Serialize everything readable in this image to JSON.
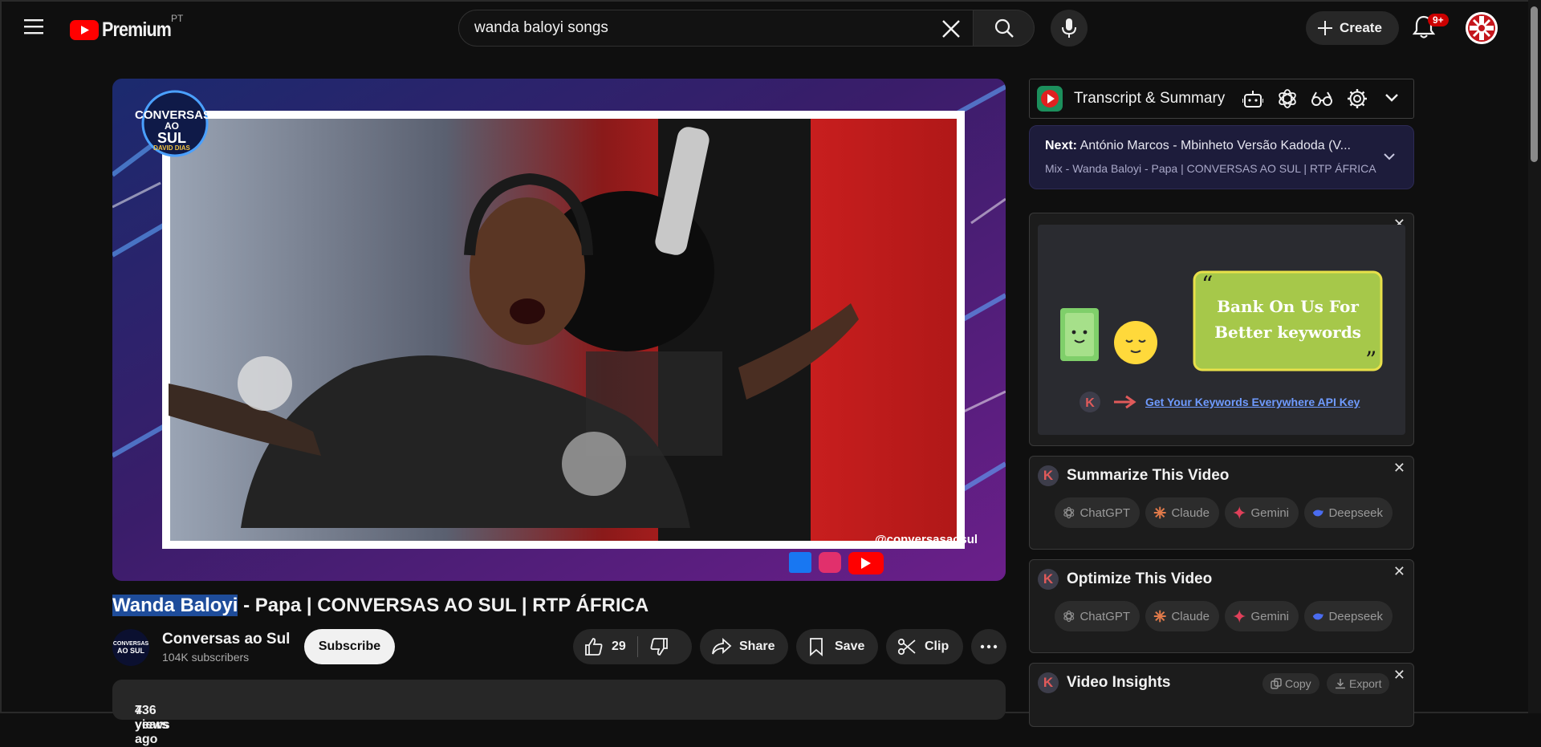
{
  "header": {
    "logo_text": "Premium",
    "country_code": "PT",
    "search_value": "wanda baloyi songs",
    "create_label": "Create",
    "notification_badge": "9+"
  },
  "video": {
    "watermark_handle": "@conversasaosul",
    "overlay_logo_line1": "CONVERSAS",
    "overlay_logo_line2": "AO",
    "overlay_logo_line3": "SUL",
    "overlay_logo_line4": "DAVID DIAS",
    "title_highlight": "Wanda Baloyi",
    "title_rest": " - Papa | CONVERSAS AO SUL | RTP ÁFRICA",
    "channel_name": "Conversas ao Sul",
    "subscribers": "104K subscribers",
    "subscribe_label": "Subscribe",
    "like_count": "29",
    "share_label": "Share",
    "save_label": "Save",
    "clip_label": "Clip",
    "views": "736 views",
    "age": "4 years ago"
  },
  "sidebar": {
    "transcript_title": "Transcript & Summary",
    "next_label": "Next:",
    "next_title": "António Marcos - Mbinheto Versão Kadoda (V...",
    "next_mix": "Mix - Wanda Baloyi - Papa | CONVERSAS AO SUL | RTP ÁFRICA",
    "ad_line1": "Bank On Us For",
    "ad_line2": "Better keywords",
    "ad_link": "Get Your Keywords Everywhere API Key",
    "summarize_title": "Summarize This Video",
    "optimize_title": "Optimize This Video",
    "insights_title": "Video Insights",
    "copy_label": "Copy",
    "export_label": "Export",
    "ai_buttons": [
      "ChatGPT",
      "Claude",
      "Gemini",
      "Deepseek"
    ]
  },
  "colors": {
    "youtube_red": "#ff0000",
    "highlight": "#1e4c9a",
    "ad_green": "#a6c84a"
  }
}
